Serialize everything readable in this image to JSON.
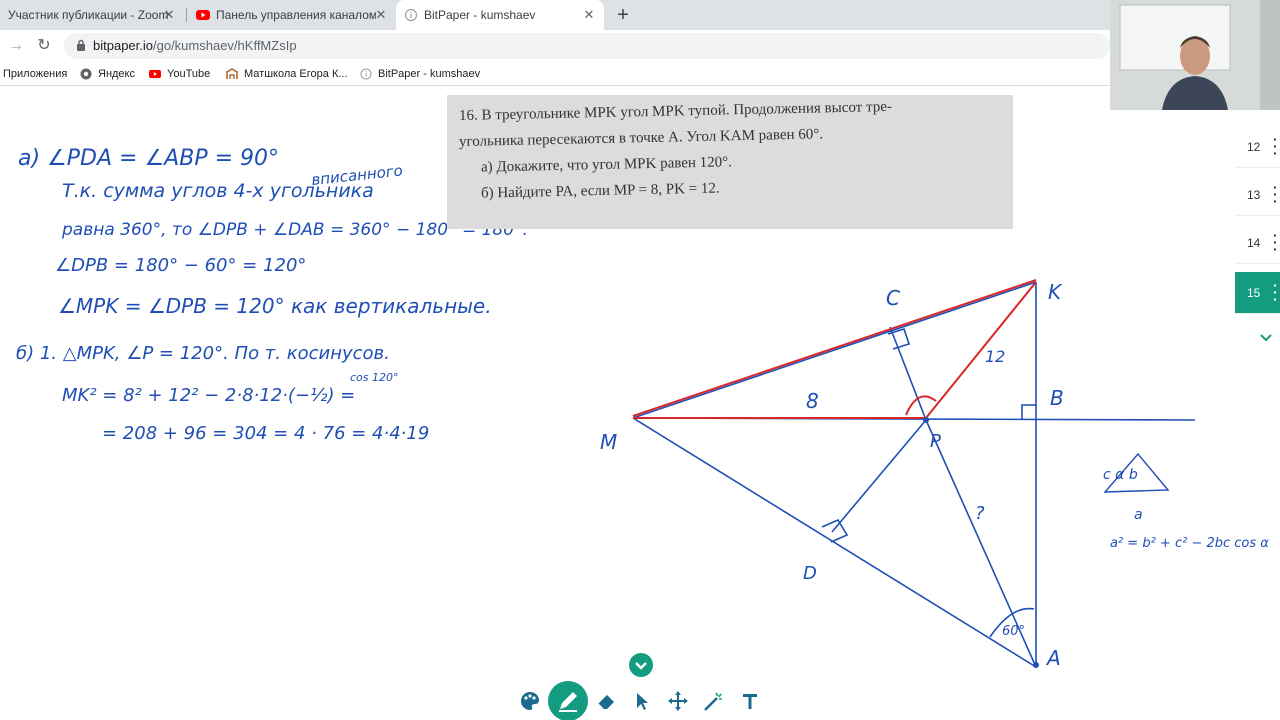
{
  "browser": {
    "tabs": [
      {
        "title": "Участник публикации - Zoom"
      },
      {
        "title": "Панель управления каналом - Y"
      },
      {
        "title": "BitPaper - kumshaev"
      }
    ],
    "url_host": "bitpaper.io",
    "url_path": "/go/kumshaev/hKffMZsIp",
    "bookmarks": [
      "Приложения",
      "Яндекс",
      "YouTube",
      "Матшкола Егора К...",
      "BitPaper - kumshaev"
    ]
  },
  "problem": {
    "line1": "16. В треугольнике MPK угол MPK тупой. Продолжения высот тре-",
    "line2": "угольника пересекаются в точке A. Угол KAM равен 60°.",
    "line3": "а) Докажите, что угол MPK равен 120°.",
    "line4": "б) Найдите PA, если MP = 8, PK = 12."
  },
  "notes": {
    "l1": "а)  ∠PDA = ∠ABP = 90°",
    "l1b": "вписанного",
    "l2": "Т.к. сумма углов 4-х угольника",
    "l3": "равна  360°, то ∠DPB + ∠DAB = 360° − 180° = 180°.",
    "l4": "∠DPB = 180° − 60° = 120°",
    "l5": "∠MPK = ∠DPB = 120°    как вертикальные.",
    "l6": "б)  1. △MPK,  ∠P = 120°.   По  т. косинусов.",
    "l6b": "cos 120°",
    "l7": "MK² =  8² + 12² −  2·8·12·(−½)  =",
    "l8": "=  208 + 96  =  304 = 4 · 76  =  4·4·19",
    "side_note1": "c   α   b",
    "side_note2": "a",
    "side_note3": "a² = b² + c² − 2bc cos α"
  },
  "diagram_labels": {
    "M": "M",
    "P": "P",
    "K": "K",
    "C": "C",
    "B": "B",
    "A": "A",
    "D": "D",
    "mp": "8",
    "pk": "12",
    "pa": "?",
    "angle_a": "60°"
  },
  "pages": [
    "12",
    "13",
    "14",
    "15"
  ],
  "active_page": "15",
  "tools": [
    "palette-tool",
    "pen-tool",
    "eraser-tool",
    "select-tool",
    "move-tool",
    "laser-tool",
    "text-tool"
  ],
  "colors": {
    "accent": "#139c7f",
    "ink_blue": "#1f4fb5",
    "ink_red": "#d9262b"
  }
}
